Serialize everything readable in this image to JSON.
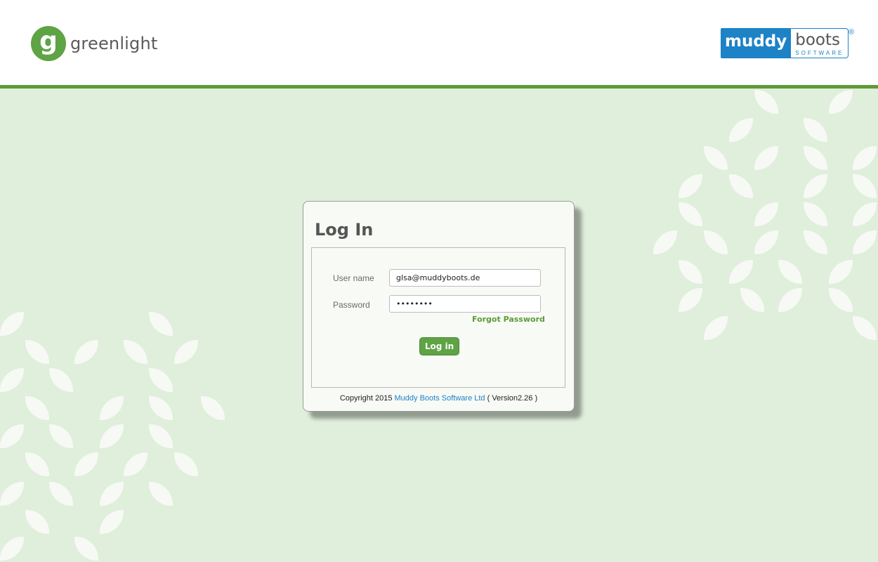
{
  "header": {
    "greenlight_logo": {
      "glyph": "g",
      "text": "greenlight",
      "color": "#5ea344"
    },
    "muddyboots_logo": {
      "word1": "muddy",
      "word2": "boots",
      "sub": "SOFTWARE",
      "reg": "®",
      "color": "#1e82c6"
    },
    "accent_color": "#5e9a37"
  },
  "login": {
    "title": "Log In",
    "username_label": "User name",
    "username_value": "glsa@muddyboots.de",
    "password_label": "Password",
    "password_value": "••••••••",
    "forgot_password": "Forgot Password",
    "login_button": "Log in"
  },
  "footer": {
    "copyright_prefix": "Copyright 2015",
    "company_link": "Muddy Boots Software Ltd",
    "version": "( Version2.26 )"
  }
}
